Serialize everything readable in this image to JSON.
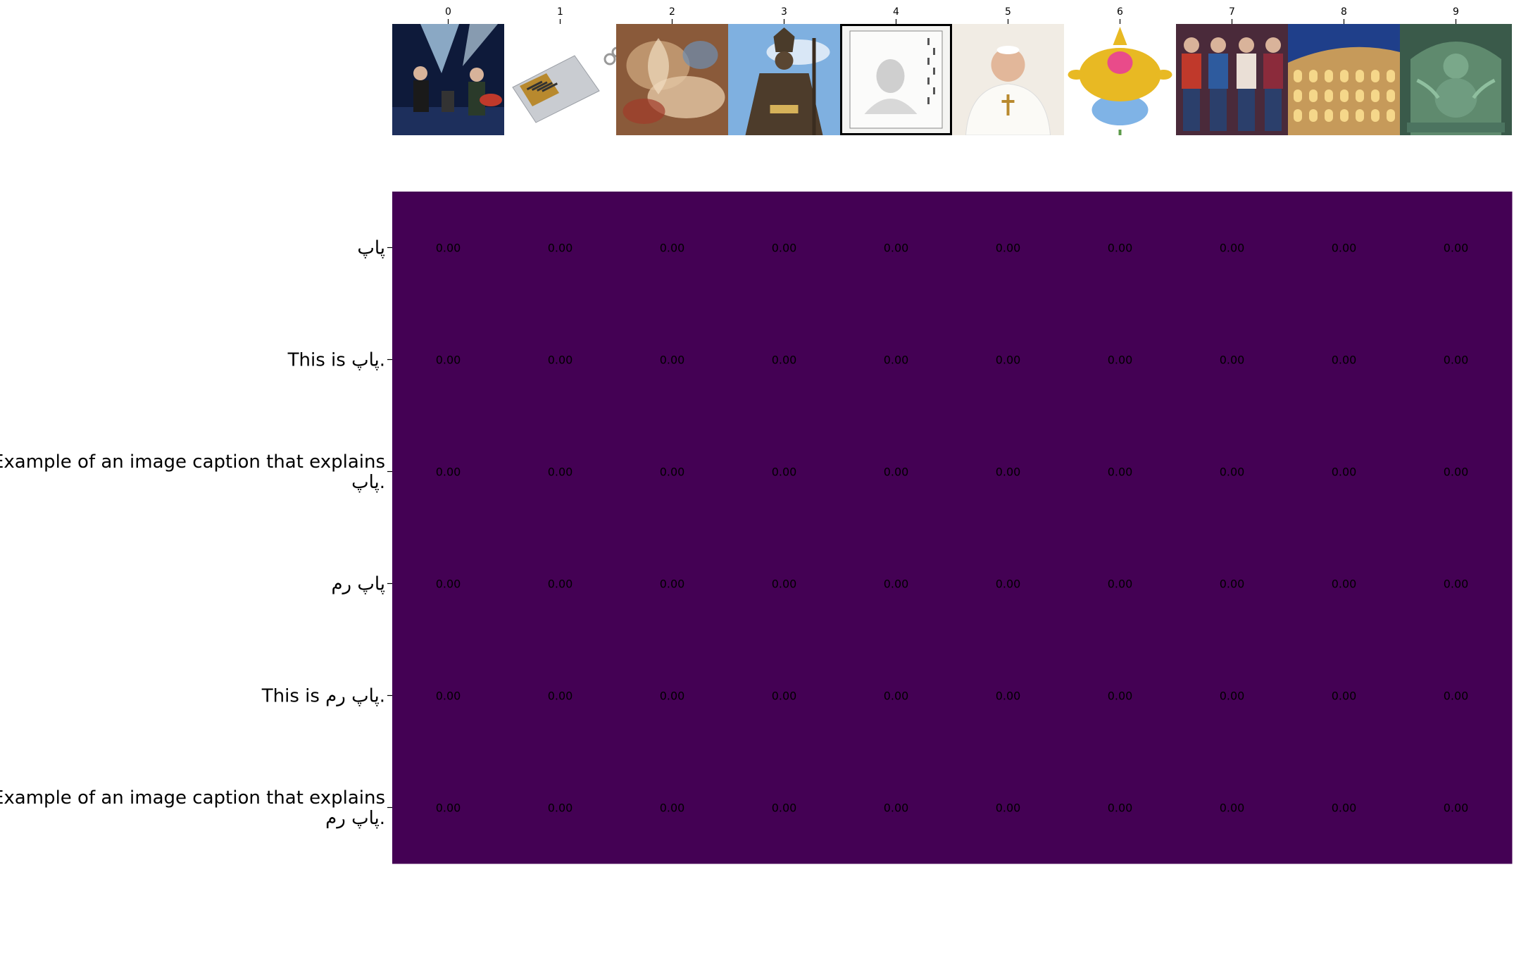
{
  "chart_data": {
    "type": "heatmap",
    "title": "",
    "xlabel": "",
    "ylabel": "",
    "x_tick_labels": [
      "0",
      "1",
      "2",
      "3",
      "4",
      "5",
      "6",
      "7",
      "8",
      "9"
    ],
    "column_images": [
      "band-concert-photo",
      "usb-flash-drive-photo",
      "baroque-painting",
      "bishop-statue-photo",
      "framed-vintage-portrait",
      "pope-portrait-photo",
      "golden-deity-ornament",
      "group-of-young-men-photo",
      "colosseum-night-photo",
      "stone-deity-relief-sculpture"
    ],
    "row_labels": [
      [
        "پاپ"
      ],
      [
        "This is پاپ."
      ],
      [
        "Example of an image caption that explains",
        "پاپ."
      ],
      [
        "پاپ رم"
      ],
      [
        "This is پاپ رم."
      ],
      [
        "Example of an image caption that explains",
        "پاپ رم."
      ]
    ],
    "values": [
      [
        0.0,
        0.0,
        0.0,
        0.0,
        0.0,
        0.0,
        0.0,
        0.0,
        0.0,
        0.0
      ],
      [
        0.0,
        0.0,
        0.0,
        0.0,
        0.0,
        0.0,
        0.0,
        0.0,
        0.0,
        0.0
      ],
      [
        0.0,
        0.0,
        0.0,
        0.0,
        0.0,
        0.0,
        0.0,
        0.0,
        0.0,
        0.0
      ],
      [
        0.0,
        0.0,
        0.0,
        0.0,
        0.0,
        0.0,
        0.0,
        0.0,
        0.0,
        0.0
      ],
      [
        0.0,
        0.0,
        0.0,
        0.0,
        0.0,
        0.0,
        0.0,
        0.0,
        0.0,
        0.0
      ],
      [
        0.0,
        0.0,
        0.0,
        0.0,
        0.0,
        0.0,
        0.0,
        0.0,
        0.0,
        0.0
      ]
    ],
    "value_format": "0.00",
    "colormap": "viridis",
    "colors": {
      "heatmap_fill": "#440154",
      "cell_text": "#000000"
    }
  }
}
